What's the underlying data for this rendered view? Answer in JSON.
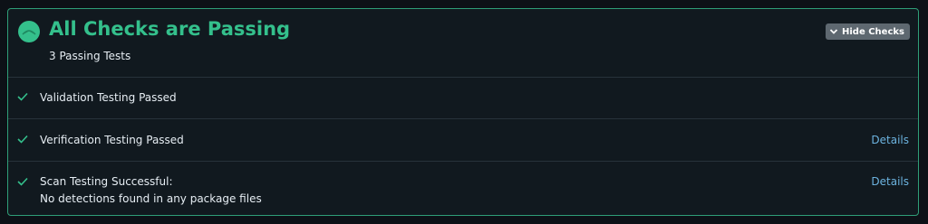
{
  "header": {
    "title": "All Checks are Passing",
    "subtitle": "3 Passing Tests",
    "hide_button_label": "Hide Checks"
  },
  "checks": [
    {
      "line1": "Validation Testing Passed",
      "line2": "",
      "details_label": ""
    },
    {
      "line1": "Verification Testing Passed",
      "line2": "",
      "details_label": "Details"
    },
    {
      "line1": "Scan Testing Successful:",
      "line2": "No detections found in any package files",
      "details_label": "Details"
    }
  ],
  "colors": {
    "accent_green": "#34c08c",
    "link_blue": "#6cb3df",
    "panel_border": "#2f9e78",
    "panel_bg": "#11191f"
  },
  "icons": {
    "status": "status-dot-icon",
    "check": "checkmark-icon",
    "chevron": "chevron-down-icon"
  }
}
